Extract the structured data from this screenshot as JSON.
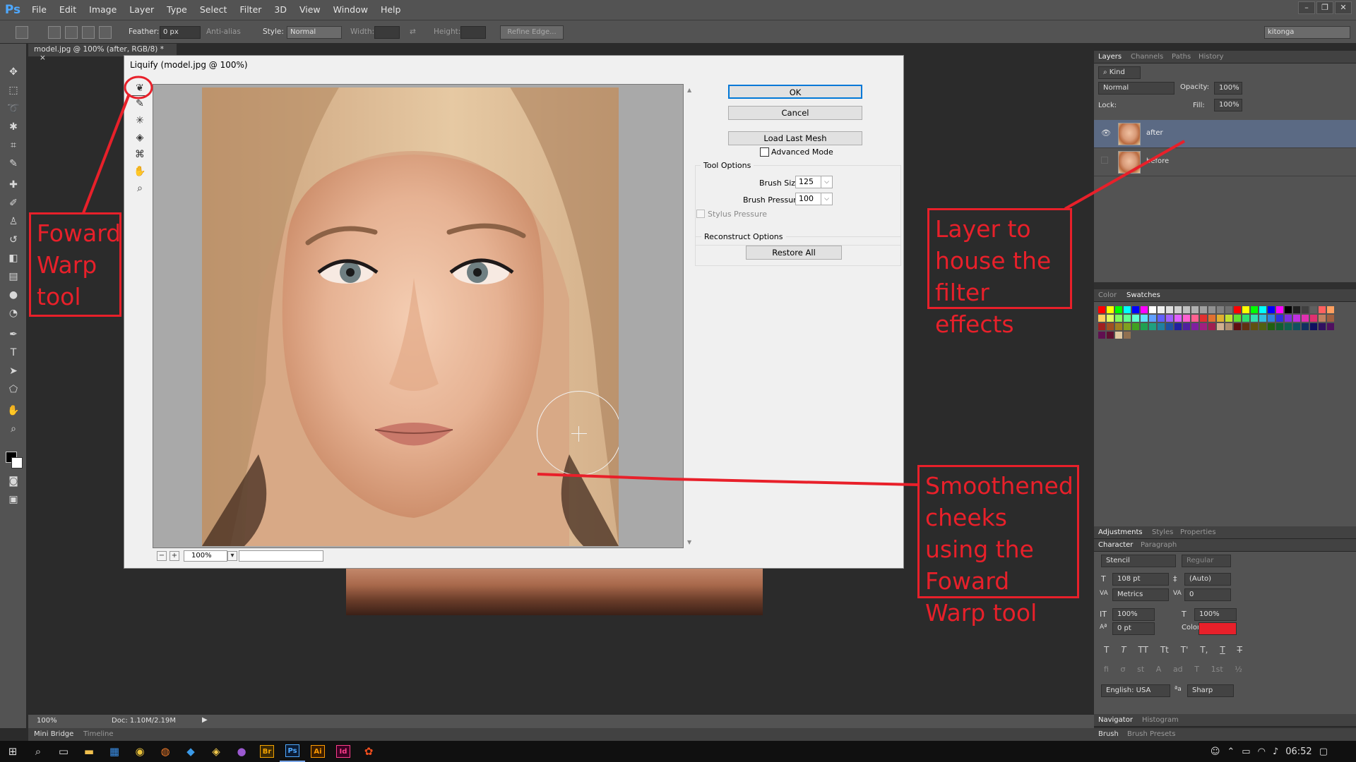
{
  "app": {
    "logo": "Ps",
    "menu": [
      "File",
      "Edit",
      "Image",
      "Layer",
      "Type",
      "Select",
      "Filter",
      "3D",
      "View",
      "Window",
      "Help"
    ],
    "workspace": "kitonga"
  },
  "options_bar": {
    "feather_label": "Feather:",
    "feather_value": "0 px",
    "antialias_label": "Anti-alias",
    "style_label": "Style:",
    "style_value": "Normal",
    "width_label": "Width:",
    "height_label": "Height:",
    "refine_edge": "Refine Edge..."
  },
  "document": {
    "tab_title": "model.jpg @ 100% (after, RGB/8) *",
    "tab_close": "×",
    "status_zoom": "100%",
    "status_doc": "Doc: 1.10M/2.19M"
  },
  "liquify": {
    "title": "Liquify (model.jpg @ 100%)",
    "ok": "OK",
    "cancel": "Cancel",
    "load_last_mesh": "Load Last Mesh",
    "advanced_mode": "Advanced Mode",
    "tool_options_title": "Tool Options",
    "brush_size_label": "Brush Size:",
    "brush_size_value": "125",
    "brush_pressure_label": "Brush Pressure:",
    "brush_pressure_value": "100",
    "stylus_pressure": "Stylus Pressure",
    "reconstruct_title": "Reconstruct Options",
    "restore_all": "Restore All",
    "zoom_value": "100%",
    "zoom_minus": "−",
    "zoom_plus": "+"
  },
  "layers_panel": {
    "tabs": [
      "Layers",
      "Channels",
      "Paths",
      "History"
    ],
    "filter_kind": "Kind",
    "blend_mode": "Normal",
    "opacity_label": "Opacity:",
    "opacity_value": "100%",
    "lock_label": "Lock:",
    "fill_label": "Fill:",
    "fill_value": "100%",
    "layers": [
      {
        "name": "after",
        "selected": true,
        "visible": true
      },
      {
        "name": "before",
        "selected": false,
        "visible": false
      }
    ]
  },
  "color_panel": {
    "tabs": [
      "Color",
      "Swatches"
    ],
    "swatch_colors": [
      "#ff0000",
      "#ffff00",
      "#00ff00",
      "#00ffff",
      "#0000ff",
      "#ff00ff",
      "#ffffff",
      "#f0f0f0",
      "#e0e0e0",
      "#d0d0d0",
      "#c0c0c0",
      "#b0b0b0",
      "#a0a0a0",
      "#909090",
      "#808080",
      "#707070",
      "#ff0000",
      "#ffff00",
      "#00ff00",
      "#00ffff",
      "#0000ff",
      "#ff00ff",
      "#000000",
      "#202020",
      "#404040",
      "#606060",
      "#ff6060",
      "#ffa060",
      "#ffd060",
      "#e0ff60",
      "#80ff60",
      "#60ff90",
      "#60ffd0",
      "#60e0ff",
      "#60a0ff",
      "#6060ff",
      "#a060ff",
      "#e060ff",
      "#ff60d0",
      "#ff6090",
      "#e03030",
      "#e07030",
      "#e0b030",
      "#c0e030",
      "#60e030",
      "#30e070",
      "#30e0b0",
      "#30c0e0",
      "#3080e0",
      "#3030e0",
      "#8030e0",
      "#c030e0",
      "#e030b0",
      "#e03070",
      "#c08060",
      "#a06040",
      "#a02020",
      "#a05020",
      "#a08020",
      "#80a020",
      "#40a020",
      "#20a050",
      "#20a080",
      "#2080a0",
      "#2050a0",
      "#2020a0",
      "#5020a0",
      "#8020a0",
      "#a02080",
      "#a02050",
      "#d0b090",
      "#b09070",
      "#601010",
      "#603010",
      "#605010",
      "#506010",
      "#206010",
      "#106030",
      "#106050",
      "#105060",
      "#103060",
      "#101060",
      "#301060",
      "#501060",
      "#601050",
      "#601030",
      "#e0c8a0",
      "#907050"
    ]
  },
  "adjustments_panel": {
    "tabs": [
      "Adjustments",
      "Styles",
      "Properties"
    ]
  },
  "character_panel": {
    "tabs": [
      "Character",
      "Paragraph"
    ],
    "font": "Stencil",
    "style": "Regular",
    "size": "108 pt",
    "leading": "(Auto)",
    "kerning": "Metrics",
    "tracking": "0",
    "vscale": "100%",
    "hscale": "100%",
    "baseline": "0 pt",
    "color_label": "Color:",
    "color_value": "#e8202a",
    "language": "English: USA",
    "antialias": "Sharp",
    "type_buttons": [
      "T",
      "T",
      "TT",
      "Tt",
      "T'",
      "T,",
      "T",
      "T"
    ],
    "ot_buttons": [
      "fi",
      "σ",
      "st",
      "A",
      "ad",
      "T",
      "1st",
      "½"
    ]
  },
  "bottom_panels": {
    "navigator_tabs": [
      "Navigator",
      "Histogram"
    ],
    "brush_tabs": [
      "Brush",
      "Brush Presets"
    ],
    "mini_tabs": [
      "Mini Bridge",
      "Timeline"
    ]
  },
  "annotations": {
    "forward_warp": "Foward Warp tool",
    "layer_house": "Layer to house the filter effects",
    "smoothened": "Smoothened cheeks using the Foward Warp tool",
    "color": "#e8202a"
  },
  "taskbar": {
    "time": "06:52",
    "apps": [
      "Br",
      "Ps",
      "Ai",
      "Id"
    ]
  }
}
